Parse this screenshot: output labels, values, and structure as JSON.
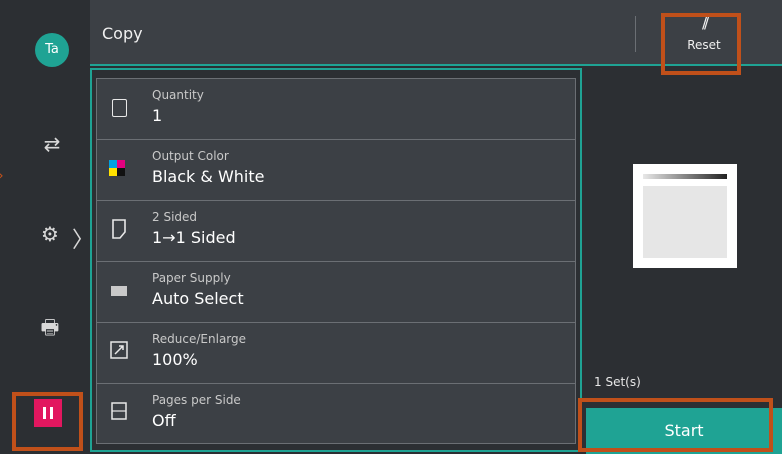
{
  "user": {
    "initials": "Ta"
  },
  "header": {
    "title": "Copy",
    "reset_label": "Reset"
  },
  "functions": [
    {
      "caption": "Quantity",
      "value": "1",
      "icon": "copies-icon"
    },
    {
      "caption": "Output Color",
      "value": "Black & White",
      "icon": "color-icon"
    },
    {
      "caption": "2 Sided",
      "value": "1→1 Sided",
      "icon": "two-sided-icon"
    },
    {
      "caption": "Paper Supply",
      "value": "Auto Select",
      "icon": "paper-tray-icon"
    },
    {
      "caption": "Reduce/Enlarge",
      "value": "100%",
      "icon": "reduce-enlarge-icon"
    },
    {
      "caption": "Pages per Side",
      "value": "Off",
      "icon": "pages-per-side-icon"
    }
  ],
  "preview": {
    "sets_label": "1 Set(s)"
  },
  "start_label": "Start",
  "colors": {
    "accent": "#1fa394",
    "highlight": "#c0501a",
    "pause": "#e2175f"
  }
}
